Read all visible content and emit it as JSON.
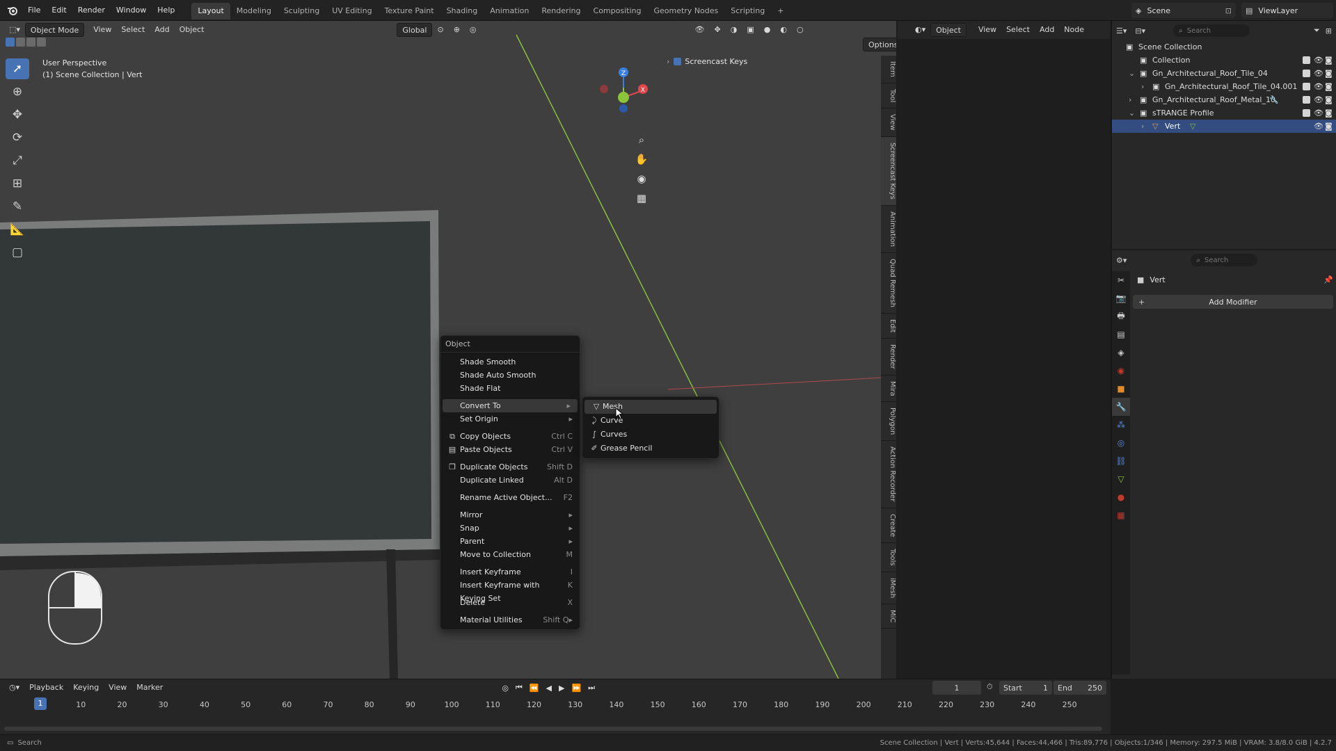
{
  "topbar": {
    "menus": [
      "File",
      "Edit",
      "Render",
      "Window",
      "Help"
    ],
    "workspaces": [
      "Layout",
      "Modeling",
      "Sculpting",
      "UV Editing",
      "Texture Paint",
      "Shading",
      "Animation",
      "Rendering",
      "Compositing",
      "Geometry Nodes",
      "Scripting"
    ],
    "active_workspace": "Layout",
    "add_tab": "+",
    "scene": "Scene",
    "view_layer": "ViewLayer"
  },
  "viewport_header": {
    "mode": "Object Mode",
    "menus": [
      "View",
      "Select",
      "Add",
      "Object"
    ],
    "transform": "Global",
    "options": "Options"
  },
  "viewport_overlay": {
    "perspective": "User Perspective",
    "collection_info": "(1) Scene Collection | Vert",
    "screencast_keys": "Screencast Keys",
    "gizmo": {
      "x": "X",
      "y": "Y",
      "z": "Z"
    }
  },
  "side_tabs": [
    "Item",
    "Tool",
    "View",
    "Screencast Keys",
    "Animation",
    "Quad Remesh",
    "Edit",
    "Render",
    "Mira",
    "Polygon",
    "Action Recorder",
    "Create",
    "Tools",
    "iMesh",
    "MiC"
  ],
  "context_menu": {
    "title": "Object",
    "items": [
      {
        "label": "Shade Smooth",
        "shortcut": ""
      },
      {
        "label": "Shade Auto Smooth",
        "shortcut": ""
      },
      {
        "label": "Shade Flat",
        "shortcut": ""
      },
      {
        "label": "Convert To",
        "shortcut": "▸"
      },
      {
        "label": "Set Origin",
        "shortcut": "▸"
      },
      {
        "label": "Copy Objects",
        "shortcut": "Ctrl C"
      },
      {
        "label": "Paste Objects",
        "shortcut": "Ctrl V"
      },
      {
        "label": "Duplicate Objects",
        "shortcut": "Shift D"
      },
      {
        "label": "Duplicate Linked",
        "shortcut": "Alt D"
      },
      {
        "label": "Rename Active Object...",
        "shortcut": "F2"
      },
      {
        "label": "Mirror",
        "shortcut": "▸"
      },
      {
        "label": "Snap",
        "shortcut": "▸"
      },
      {
        "label": "Parent",
        "shortcut": "▸"
      },
      {
        "label": "Move to Collection",
        "shortcut": "M"
      },
      {
        "label": "Insert Keyframe",
        "shortcut": "I"
      },
      {
        "label": "Insert Keyframe with Keying Set",
        "shortcut": "K"
      },
      {
        "label": "Delete",
        "shortcut": "X"
      },
      {
        "label": "Material Utilities",
        "shortcut": "Shift Q▸"
      }
    ]
  },
  "convert_submenu": {
    "items": [
      "Mesh",
      "Curve",
      "Curves",
      "Grease Pencil"
    ]
  },
  "node_header": {
    "mode": "Object",
    "menus": [
      "View",
      "Select",
      "Add",
      "Node"
    ]
  },
  "outliner": {
    "search_placeholder": "Search",
    "rows": [
      {
        "label": "Scene Collection",
        "indent": 0
      },
      {
        "label": "Collection",
        "indent": 1
      },
      {
        "label": "Gn_Architectural_Roof_Tile_04",
        "indent": 1
      },
      {
        "label": "Gn_Architectural_Roof_Tile_04.001",
        "indent": 2
      },
      {
        "label": "Gn_Architectural_Roof_Metal_10",
        "indent": 1
      },
      {
        "label": "sTRANGE Profile",
        "indent": 1
      },
      {
        "label": "Vert",
        "indent": 2
      }
    ],
    "selected": "Vert"
  },
  "properties": {
    "search_placeholder": "Search",
    "object_name": "Vert",
    "add_modifier": "Add Modifier"
  },
  "timeline": {
    "menus": [
      "Playback",
      "Keying",
      "View",
      "Marker"
    ],
    "current_frame": "1",
    "start_label": "Start",
    "start": "1",
    "end_label": "End",
    "end": "250",
    "ticks": [
      "10",
      "20",
      "30",
      "40",
      "50",
      "60",
      "70",
      "80",
      "90",
      "100",
      "110",
      "120",
      "130",
      "140",
      "150",
      "160",
      "170",
      "180",
      "190",
      "200",
      "210",
      "220",
      "230",
      "240",
      "250"
    ],
    "cursor": "1"
  },
  "statusbar": {
    "left": "Search",
    "right": "Scene Collection | Vert | Verts:45,644 | Faces:44,466 | Tris:89,776 | Objects:1/346 | Memory: 297.5 MiB | VRAM: 3.8/8.0 GiB | 4.2.7"
  },
  "colors": {
    "accent": "#4772b3",
    "x_axis": "#e0474c",
    "y_axis": "#8cc43c",
    "z_axis": "#3d7fe0",
    "selection": "#334d80"
  }
}
